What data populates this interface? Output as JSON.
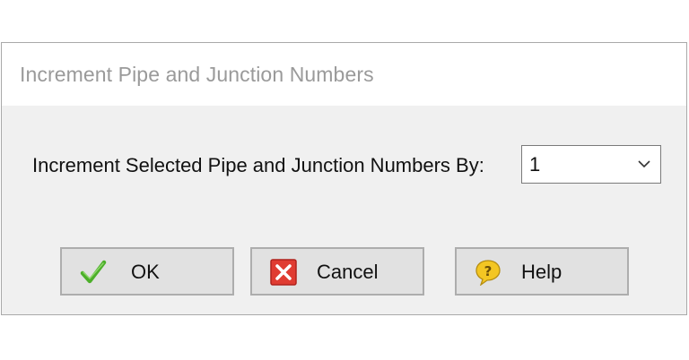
{
  "dialog": {
    "title": "Increment Pipe and Junction Numbers",
    "field_label": "Increment Selected Pipe and Junction Numbers By:",
    "increment_value": "1",
    "buttons": {
      "ok": "OK",
      "cancel": "Cancel",
      "help": "Help"
    }
  },
  "colors": {
    "dialog_background": "#f0f0f0",
    "title_bar": "#ffffff",
    "title_text": "#9a9a9a",
    "button_face": "#e1e1e1",
    "ok_check": "#4caf2a",
    "cancel_red": "#e03c32",
    "help_yellow": "#f3c623"
  },
  "icons": {
    "ok": "checkmark-icon",
    "cancel": "red-x-icon",
    "help": "question-bubble-icon",
    "combo": "chevron-down-icon"
  }
}
